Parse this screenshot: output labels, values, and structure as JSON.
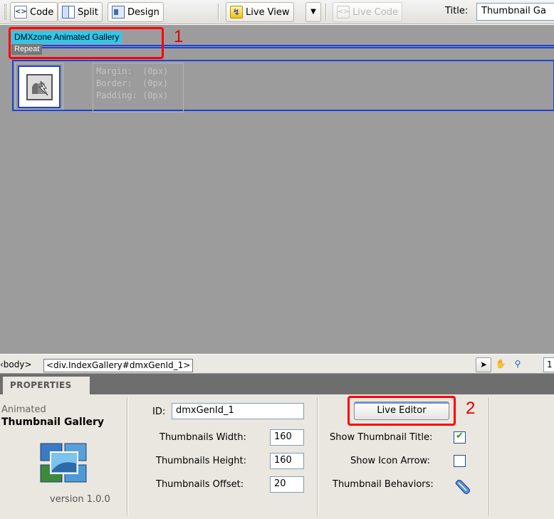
{
  "toolbar": {
    "code_label": "Code",
    "split_label": "Split",
    "design_label": "Design",
    "live_view_label": "Live View",
    "live_code_label": "Live Code",
    "title_label": "Title:",
    "title_value": "Thumbnail Ga"
  },
  "canvas": {
    "gallery_tag": "DMXzone Animated Gallery",
    "repeat_tag": "Repeat",
    "box_model": {
      "margin": "Margin:  (0px)",
      "border": "Border:  (0px)",
      "padding": "Padding: (0px)"
    },
    "callout_1": "1",
    "callout_2": "2"
  },
  "statusbar": {
    "body_tag": "‹body>",
    "div_tag": "<div.IndexGallery#dmxGenId_1>",
    "zoom_value": "1"
  },
  "properties": {
    "tab_label": "PROPERTIES",
    "widget_name_line1": "Animated",
    "widget_name_line2": "Thumbnail Gallery",
    "version": "version 1.0.0",
    "id_label": "ID:",
    "id_value": "dmxGenId_1",
    "width_label": "Thumbnails Width:",
    "width_value": "160",
    "height_label": "Thumbnails Height:",
    "height_value": "160",
    "offset_label": "Thumbnails Offset:",
    "offset_value": "20",
    "live_editor_label": "Live Editor",
    "show_title_label": "Show Thumbnail Title:",
    "show_title_checked": true,
    "show_arrow_label": "Show Icon Arrow:",
    "show_arrow_checked": false,
    "behaviors_label": "Thumbnail Behaviors:"
  },
  "colors": {
    "canvas_bg": "#9c9c9c",
    "selection_blue": "#1d42d6",
    "tag_cyan": "#2fc8ec",
    "callout_red": "#ff0000",
    "panel_bg": "#e9e7df"
  }
}
